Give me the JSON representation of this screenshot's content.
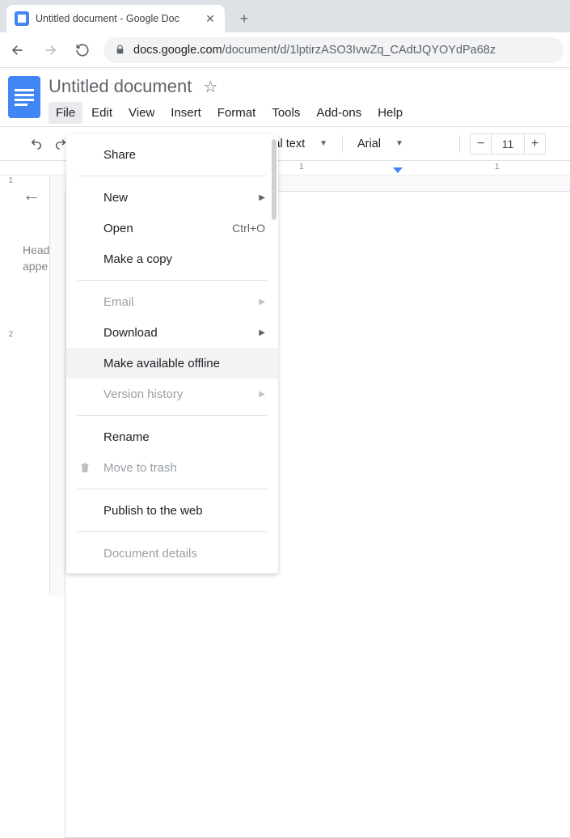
{
  "browser": {
    "tab_title": "Untitled document - Google Doc",
    "url_host": "docs.google.com",
    "url_path": "/document/d/1lptirzASO3IvwZq_CAdtJQYOYdPa68z"
  },
  "doc": {
    "title": "Untitled document",
    "menu": [
      "File",
      "Edit",
      "View",
      "Insert",
      "Format",
      "Tools",
      "Add-ons",
      "Help"
    ],
    "active_menu": "File"
  },
  "toolbar": {
    "style_label": "nal text",
    "font_label": "Arial",
    "font_size": "11"
  },
  "ruler": {
    "marks": [
      "1",
      "1"
    ]
  },
  "outline": {
    "hint": "Head\nappe",
    "vruler": [
      "1",
      "",
      "2"
    ]
  },
  "file_menu": {
    "share": "Share",
    "new": "New",
    "open": "Open",
    "open_shortcut": "Ctrl+O",
    "make_copy": "Make a copy",
    "email": "Email",
    "download": "Download",
    "make_offline": "Make available offline",
    "version_history": "Version history",
    "rename": "Rename",
    "move_to_trash": "Move to trash",
    "publish": "Publish to the web",
    "doc_details": "Document details"
  }
}
